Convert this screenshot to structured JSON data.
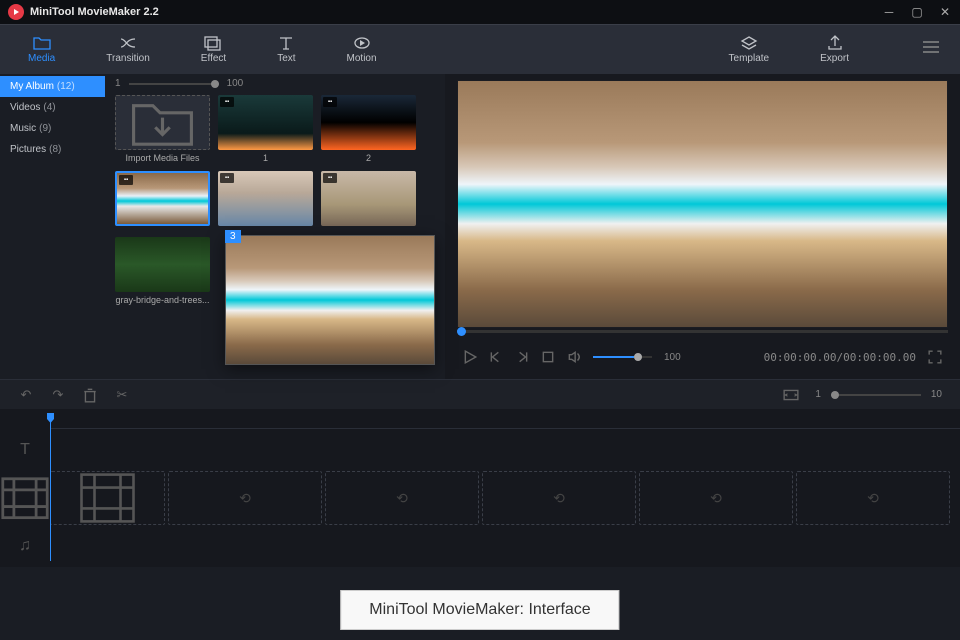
{
  "app": {
    "title": "MiniTool MovieMaker 2.2"
  },
  "toolbar": {
    "media": "Media",
    "transition": "Transition",
    "effect": "Effect",
    "text": "Text",
    "motion": "Motion",
    "template": "Template",
    "export": "Export"
  },
  "sidebar": {
    "items": [
      {
        "label": "My Album",
        "count": "(12)"
      },
      {
        "label": "Videos",
        "count": "(4)"
      },
      {
        "label": "Music",
        "count": "(9)"
      },
      {
        "label": "Pictures",
        "count": "(8)"
      }
    ]
  },
  "media": {
    "zoom_min": "1",
    "zoom_max": "100",
    "import_label": "Import Media Files",
    "items": [
      {
        "label": "1"
      },
      {
        "label": "2"
      },
      {
        "label": ""
      },
      {
        "label": ""
      },
      {
        "label": ""
      },
      {
        "label": "gray-bridge-and-trees..."
      }
    ],
    "drag_count": "3"
  },
  "preview": {
    "volume": "100",
    "time_current": "00:00:00.00",
    "time_total": "00:00:00.00"
  },
  "timeline": {
    "zoom_min": "1",
    "zoom_max": "10"
  },
  "caption": "MiniTool MovieMaker: Interface"
}
